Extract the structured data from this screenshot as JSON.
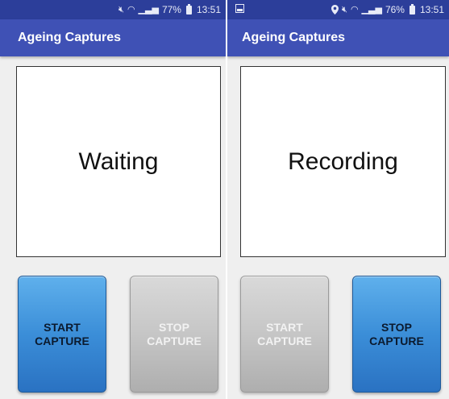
{
  "screens": [
    {
      "status_bar": {
        "notif_icon": "",
        "signal_icons": "mute-icon wifi-icon signal-icon",
        "battery_percent": "77%",
        "time": "13:51"
      },
      "app_title": "Ageing Captures",
      "status_text": "Waiting",
      "start_button": {
        "label": "START\nCAPTURE",
        "state": "enabled"
      },
      "stop_button": {
        "label": "STOP\nCAPTURE",
        "state": "disabled"
      }
    },
    {
      "status_bar": {
        "notif_icon": "image-notification-icon",
        "signal_icons": "location-icon mute-icon wifi-icon signal-icon",
        "battery_percent": "76%",
        "time": "13:51"
      },
      "app_title": "Ageing Captures",
      "status_text": "Recording",
      "start_button": {
        "label": "START\nCAPTURE",
        "state": "disabled"
      },
      "stop_button": {
        "label": "STOP\nCAPTURE",
        "state": "enabled"
      }
    }
  ],
  "colors": {
    "status_bar": "#2c3e9a",
    "app_bar": "#3f51b5",
    "active_button": "#3b8ed8",
    "disabled_button": "#c6c6c6",
    "background": "#efefef"
  }
}
